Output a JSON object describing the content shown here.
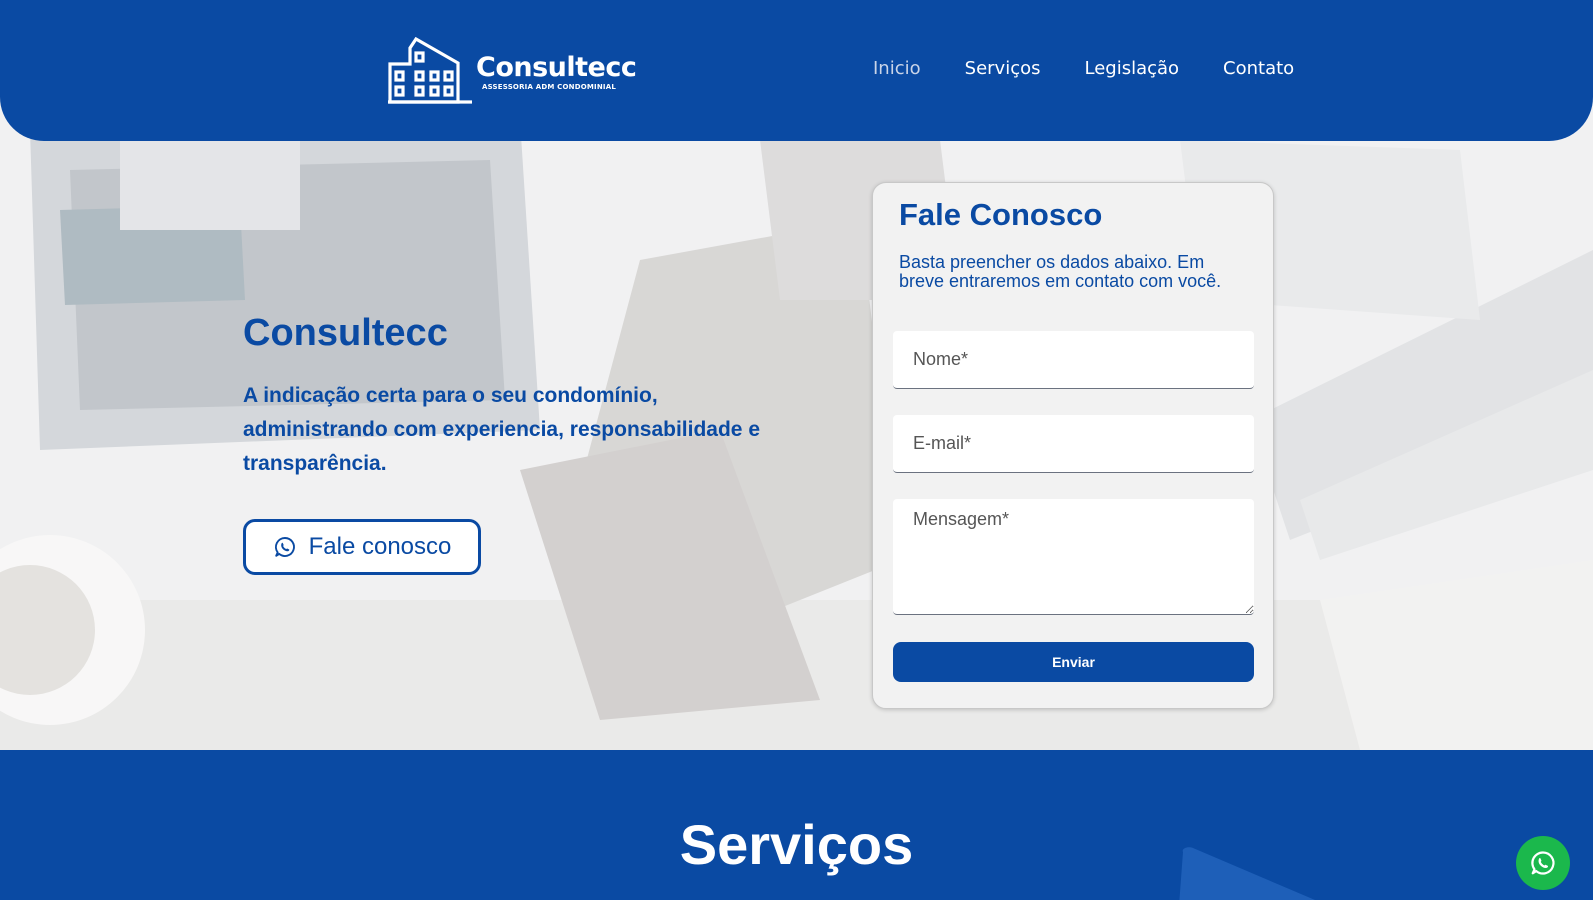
{
  "header": {
    "logo": {
      "name": "Consultecc",
      "subtitle": "ASSESSORIA ADM CONDOMINIAL",
      "icon": "building-icon"
    },
    "nav": [
      {
        "label": "Inicio",
        "active": false
      },
      {
        "label": "Serviços",
        "active": true
      },
      {
        "label": "Legislação",
        "active": true
      },
      {
        "label": "Contato",
        "active": true
      }
    ]
  },
  "hero": {
    "title": "Consultecc",
    "text": "A indicação certa para o seu condomínio, administrando com experiencia, responsabilidade e transparência.",
    "cta": {
      "label": "Fale conosco",
      "icon": "whatsapp-icon"
    }
  },
  "contact_form": {
    "title": "Fale Conosco",
    "subtitle": "Basta preencher os dados abaixo. Em breve entraremos em contato com você.",
    "name_placeholder": "Nome*",
    "email_placeholder": "E-mail*",
    "message_placeholder": "Mensagem*",
    "submit_label": "Enviar"
  },
  "services": {
    "title": "Serviços"
  },
  "floating_whatsapp": {
    "icon": "whatsapp-icon"
  },
  "colors": {
    "brand_blue": "#0a4aa3",
    "whatsapp_green": "#1bb84c",
    "form_background": "#f2f2f2"
  }
}
